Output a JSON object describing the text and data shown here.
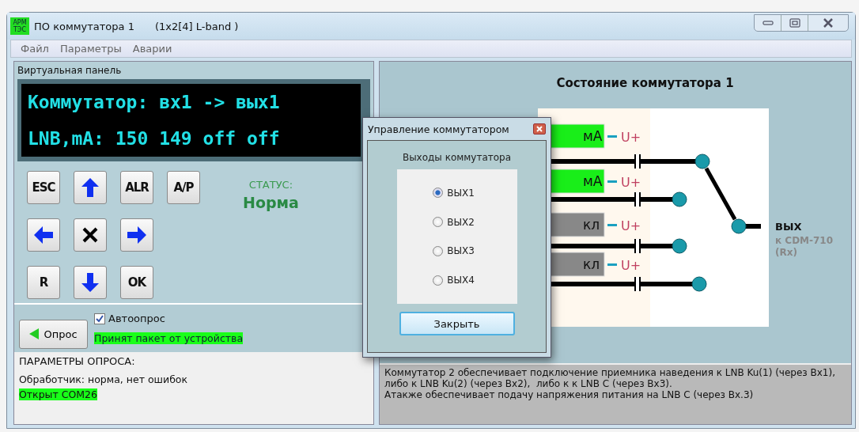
{
  "window": {
    "icon_lines": [
      "АРМ",
      "ТЭС"
    ],
    "title": "ПО коммутатора 1",
    "subtitle": "(1x2[4] L-band )"
  },
  "menu": [
    "Файл",
    "Параметры",
    "Аварии"
  ],
  "virtual_panel": {
    "title": "Виртуальная панель",
    "display_lines": [
      "Коммутатор: вх1 -> вых1",
      "LNB,mA: 150 149 off off"
    ],
    "keys": [
      {
        "kind": "text",
        "label": "ESC"
      },
      {
        "kind": "up"
      },
      {
        "kind": "text",
        "label": "ALR"
      },
      {
        "kind": "text",
        "label": "A/P"
      },
      {
        "kind": "left"
      },
      {
        "kind": "cancel"
      },
      {
        "kind": "right"
      },
      {
        "kind": "text",
        "label": "R"
      },
      {
        "kind": "down"
      },
      {
        "kind": "text",
        "label": "OK"
      }
    ],
    "status_label": "СТАТУС:",
    "status_value": "Норма"
  },
  "poll": {
    "button": "Опрос",
    "auto_poll": {
      "label": "Автоопрос",
      "checked": true
    },
    "message": "Принят пакет от устройства"
  },
  "poll_params": {
    "title": "ПАРАМЕТРЫ ОПРОСА:",
    "lines": [
      {
        "text": "Обработчик: норма, нет ошибок",
        "highlight": false
      },
      {
        "text": "Открыт COM26",
        "highlight": true
      }
    ]
  },
  "switch_state": {
    "title": "Состояние коммутатора 1",
    "inputs": [
      {
        "reading": "мА",
        "powered": true,
        "power": "U+",
        "connected": true
      },
      {
        "reading": "мА",
        "powered": true,
        "power": "U+",
        "connected": false
      },
      {
        "reading": "кл",
        "powered": false,
        "power": "U+",
        "connected": false
      },
      {
        "reading": "кл",
        "powered": false,
        "power": "U+",
        "connected": false
      }
    ],
    "output_label": "ВЫХ",
    "output_target": "к CDM-710",
    "output_note": "(Rx)"
  },
  "description": [
    "Коммутатор 2 обеспечивает подключение приемника наведения к LNB Ku(1) (через Вх1),",
    "либо к LNB Ku(2) (через Вх2),  либо к к LNB С (через Вх3).",
    "Атакже обеспечивает подачу напряжения питания на LNB С (через Вх.3)"
  ],
  "dialog": {
    "title": "Управление коммутатором",
    "group": "Выходы коммутатора",
    "options": [
      {
        "label": "ВЫХ1",
        "selected": true
      },
      {
        "label": "ВЫХ2",
        "selected": false
      },
      {
        "label": "ВЫХ3",
        "selected": false
      },
      {
        "label": "ВЫХ4",
        "selected": false
      }
    ],
    "button": "Закрыть"
  }
}
